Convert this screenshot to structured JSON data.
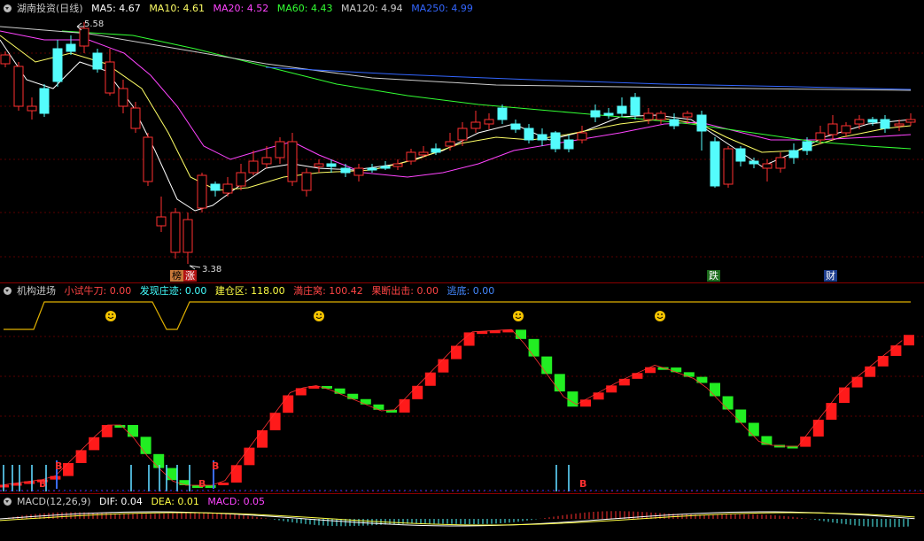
{
  "main_panel": {
    "title": "湖南投资(日线)",
    "ma": [
      {
        "label": "MA5: 4.67",
        "color": "#ffffff"
      },
      {
        "label": "MA10: 4.61",
        "color": "#ffff66"
      },
      {
        "label": "MA20: 4.52",
        "color": "#ff44ff"
      },
      {
        "label": "MA60: 4.43",
        "color": "#33ff33"
      },
      {
        "label": "MA120: 4.94",
        "color": "#cccccc"
      },
      {
        "label": "MA250: 4.99",
        "color": "#3366ff"
      }
    ],
    "high_label": "5.58",
    "low_label": "3.38",
    "tags": [
      {
        "text": "榜",
        "bg": "#c8793a",
        "color": "#000"
      },
      {
        "text": "涨",
        "bg": "#b21414",
        "color": "#fff"
      },
      {
        "text": "跌",
        "bg": "#1c6b1c",
        "color": "#fff"
      },
      {
        "text": "财",
        "bg": "#1c3c8c",
        "color": "#fff"
      }
    ]
  },
  "indicator_panel": {
    "title": "机构进场",
    "items": [
      {
        "label": "小试牛刀: 0.00",
        "color": "#ff4444"
      },
      {
        "label": "发现庄迹: 0.00",
        "color": "#44ffff"
      },
      {
        "label": "建仓区: 118.00",
        "color": "#ffff44"
      },
      {
        "label": "満庄窝: 100.42",
        "color": "#ff4444"
      },
      {
        "label": "果断出击: 0.00",
        "color": "#ff4444"
      },
      {
        "label": "逃底: 0.00",
        "color": "#4488ff"
      }
    ],
    "markers": [
      "B",
      "B",
      "B",
      "B",
      "B"
    ]
  },
  "macd_panel": {
    "title": "MACD(12,26,9)",
    "items": [
      {
        "label": "DIF: 0.04",
        "color": "#ffffff"
      },
      {
        "label": "DEA: 0.01",
        "color": "#ffff44"
      },
      {
        "label": "MACD: 0.05",
        "color": "#ff44ff"
      }
    ]
  },
  "colors": {
    "up": "#ff3030",
    "down": "#54fcfc",
    "ind_up": "#ff1a1a",
    "ind_down": "#22ee22"
  }
}
